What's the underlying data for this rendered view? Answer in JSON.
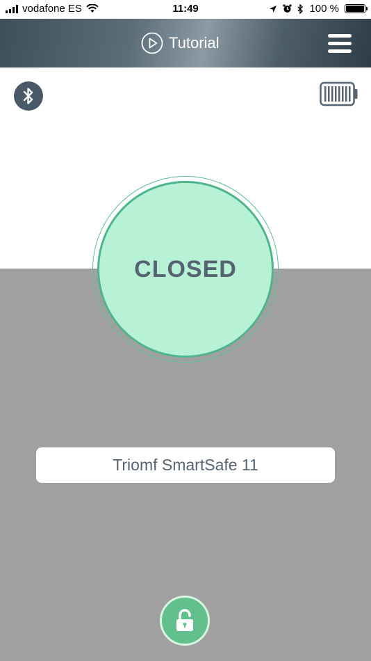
{
  "status_bar": {
    "carrier": "vodafone ES",
    "time": "11:49",
    "battery_percent": "100 %",
    "icons": [
      "signal-icon",
      "wifi-icon",
      "location-icon",
      "alarm-icon",
      "bluetooth-icon",
      "battery-icon"
    ]
  },
  "header": {
    "tutorial_label": "Tutorial",
    "icons": [
      "play-icon",
      "menu-icon"
    ]
  },
  "toolbar": {
    "icons": [
      "bluetooth-icon",
      "battery-icon"
    ]
  },
  "lock_status": {
    "text": "CLOSED",
    "color": "#b8f2d6"
  },
  "device": {
    "name": "Triomf SmartSafe 11"
  },
  "actions": {
    "icons": [
      "unlock-icon"
    ]
  },
  "colors": {
    "accent_green": "#62c08c",
    "text_slate": "#566472",
    "background_grey": "#a0a0a0"
  }
}
